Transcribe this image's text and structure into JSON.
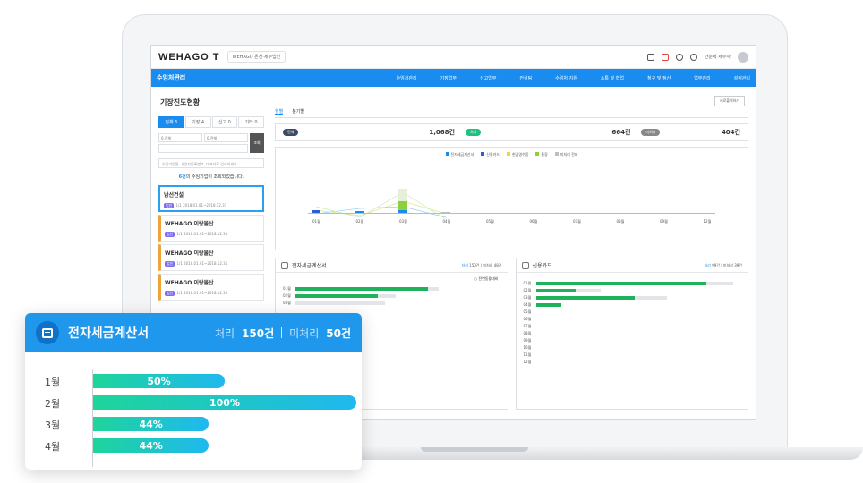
{
  "app": {
    "logo": "WEHAGO T",
    "company": "WEHAGO 온전·세무법인",
    "user": "안춘제 세무사"
  },
  "nav": {
    "title": "수임처관리",
    "items": [
      "수임처관리",
      "기장업무",
      "신고업무",
      "컨설팅",
      "수임처 지원",
      "소통 및 협업",
      "청구 및 정산",
      "업무관리",
      "설정관리"
    ]
  },
  "left": {
    "page_title": "기장진도현황",
    "filter_tabs": [
      "전체 6",
      "기장 4",
      "신고 0",
      "기타 0"
    ],
    "select1": "0.전체",
    "select2": "0.전체",
    "search_button": "조회",
    "search_placeholder": "수임기업명, 사업자등록번호, 대표자로 검색하세요.",
    "result_count": "6건",
    "result_text": "의 수임기업이 조회되었습니다.",
    "cards": [
      {
        "name": "남선건설",
        "badge": "법인",
        "meta": "1/1 2018.01.01~2018.12.31"
      },
      {
        "name": "WEHAGO 이랑물산",
        "badge": "법인",
        "meta": "1/1 2018.01.01~2018.12.31"
      },
      {
        "name": "WEHAGO 이랑물산",
        "badge": "법인",
        "meta": "1/1 2018.01.01~2018.12.31"
      },
      {
        "name": "WEHAGO 이랑물산",
        "badge": "법인",
        "meta": "1/1 2018.01.01~2018.12.31"
      }
    ]
  },
  "right": {
    "export_button": "세로출력하기",
    "tabs": [
      "월별",
      "분기별"
    ],
    "summary": {
      "total_label": "전체",
      "total_value": "1,068건",
      "done_label": "처리",
      "done_value": "664건",
      "undone_label": "미처리",
      "undone_value": "404건"
    },
    "legend": [
      "전자세금계산서",
      "신용카드",
      "현금영수증",
      "통장",
      "미처리 전표"
    ],
    "legend_colors": [
      "#1a8cf0",
      "#2b5fd9",
      "#f2d43a",
      "#8bd13e",
      "#b9bfc7"
    ],
    "months": [
      "01월",
      "02월",
      "03월",
      "04월",
      "05월",
      "06월",
      "07월",
      "08월",
      "09월",
      "12월"
    ],
    "panel1": {
      "title": "전자세금계산서",
      "done": "처리",
      "done_v": "150건",
      "undone": "미처리",
      "undone_v": "48건",
      "rows": [
        "01월",
        "02월",
        "03월"
      ],
      "check_label": "전년동월대비"
    },
    "panel2": {
      "title": "신용카드",
      "done": "처리",
      "done_v": "99건",
      "undone": "미처리",
      "undone_v": "39건",
      "rows": [
        "01월",
        "02월",
        "03월",
        "04월",
        "05월",
        "06월",
        "07월",
        "08월",
        "09월",
        "10월",
        "11월",
        "12월"
      ]
    }
  },
  "popup": {
    "title": "전자세금계산서",
    "done_label": "처리",
    "done_value": "150건",
    "undone_label": "미처리",
    "undone_value": "50건",
    "rows": [
      {
        "month": "1월",
        "label": "50%"
      },
      {
        "month": "2월",
        "label": "100%"
      },
      {
        "month": "3월",
        "label": "44%"
      },
      {
        "month": "4월",
        "label": "44%"
      }
    ]
  },
  "chart_data": {
    "type": "bar",
    "categories": [
      "1월",
      "2월",
      "3월",
      "4월"
    ],
    "values": [
      50,
      100,
      44,
      44
    ],
    "title": "전자세금계산서",
    "xlabel": "",
    "ylabel": "",
    "xlim": [
      0,
      100
    ]
  }
}
